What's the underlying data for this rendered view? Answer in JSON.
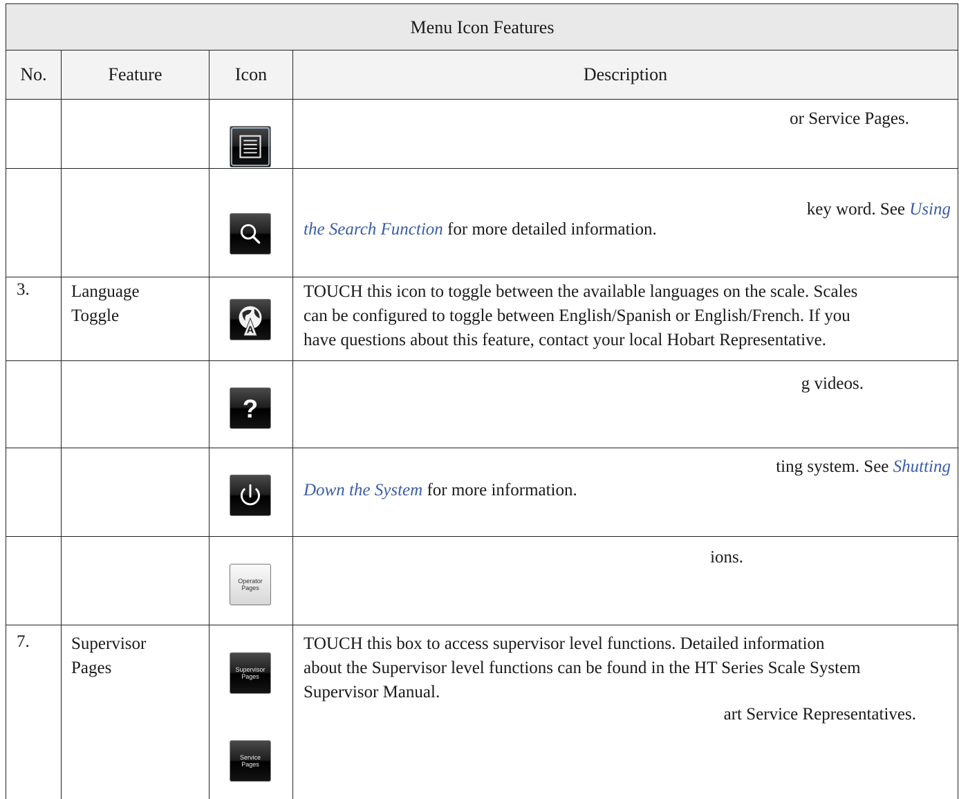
{
  "table": {
    "title": "Menu Icon Features",
    "headers": {
      "no": "No.",
      "feature": "Feature",
      "icon": "Icon",
      "description": "Description"
    },
    "rows": [
      {
        "no": "",
        "feature": "",
        "icon": "menu-list-icon",
        "description": "or Service Pages."
      },
      {
        "no": "",
        "feature": "",
        "icon": "search-icon",
        "desc_pre": "key word. See ",
        "desc_link1": "Using",
        "desc_link2": "the Search Function",
        "desc_post": " for more detailed information."
      },
      {
        "no": "3.",
        "feature_line1": "Language",
        "feature_line2": "Toggle",
        "icon": "globe-language-icon",
        "desc_line1": "TOUCH this icon to toggle between the available languages on the scale. Scales",
        "desc_line2": "can be configured to toggle between English/Spanish or English/French. If you",
        "desc_line3": "have questions about this feature, contact your local Hobart Representative."
      },
      {
        "no": "",
        "feature": "",
        "icon": "help-question-icon",
        "description": "g videos."
      },
      {
        "no": "",
        "feature": "",
        "icon": "power-icon",
        "desc_pre": "ting system. See ",
        "desc_link1": "Shutting",
        "desc_link2": "Down the System",
        "desc_post": " for more information."
      },
      {
        "no": "",
        "feature": "",
        "icon": "operator-pages-icon",
        "icon_text1": "Operator",
        "icon_text2": "Pages",
        "description": "ions."
      },
      {
        "no": "7.",
        "feature_line1": "Supervisor",
        "feature_line2": "Pages",
        "icon": "supervisor-pages-icon",
        "icon_text1": "Supervisor",
        "icon_text2": "Pages",
        "desc_line1": "TOUCH this box to access supervisor level functions. Detailed information",
        "desc_line2": "about the Supervisor level functions can be found in the HT Series Scale System",
        "desc_line3": "Supervisor Manual."
      },
      {
        "no": "",
        "feature": "",
        "icon": "service-pages-icon",
        "icon_text1": "Service",
        "icon_text2": "Pages",
        "description": "art Service Representatives."
      }
    ]
  },
  "colors": {
    "link": "#3a5ca8",
    "title_bg": "#e9e9e9",
    "header_bg": "#f3f3f3",
    "rule": "#222222"
  }
}
